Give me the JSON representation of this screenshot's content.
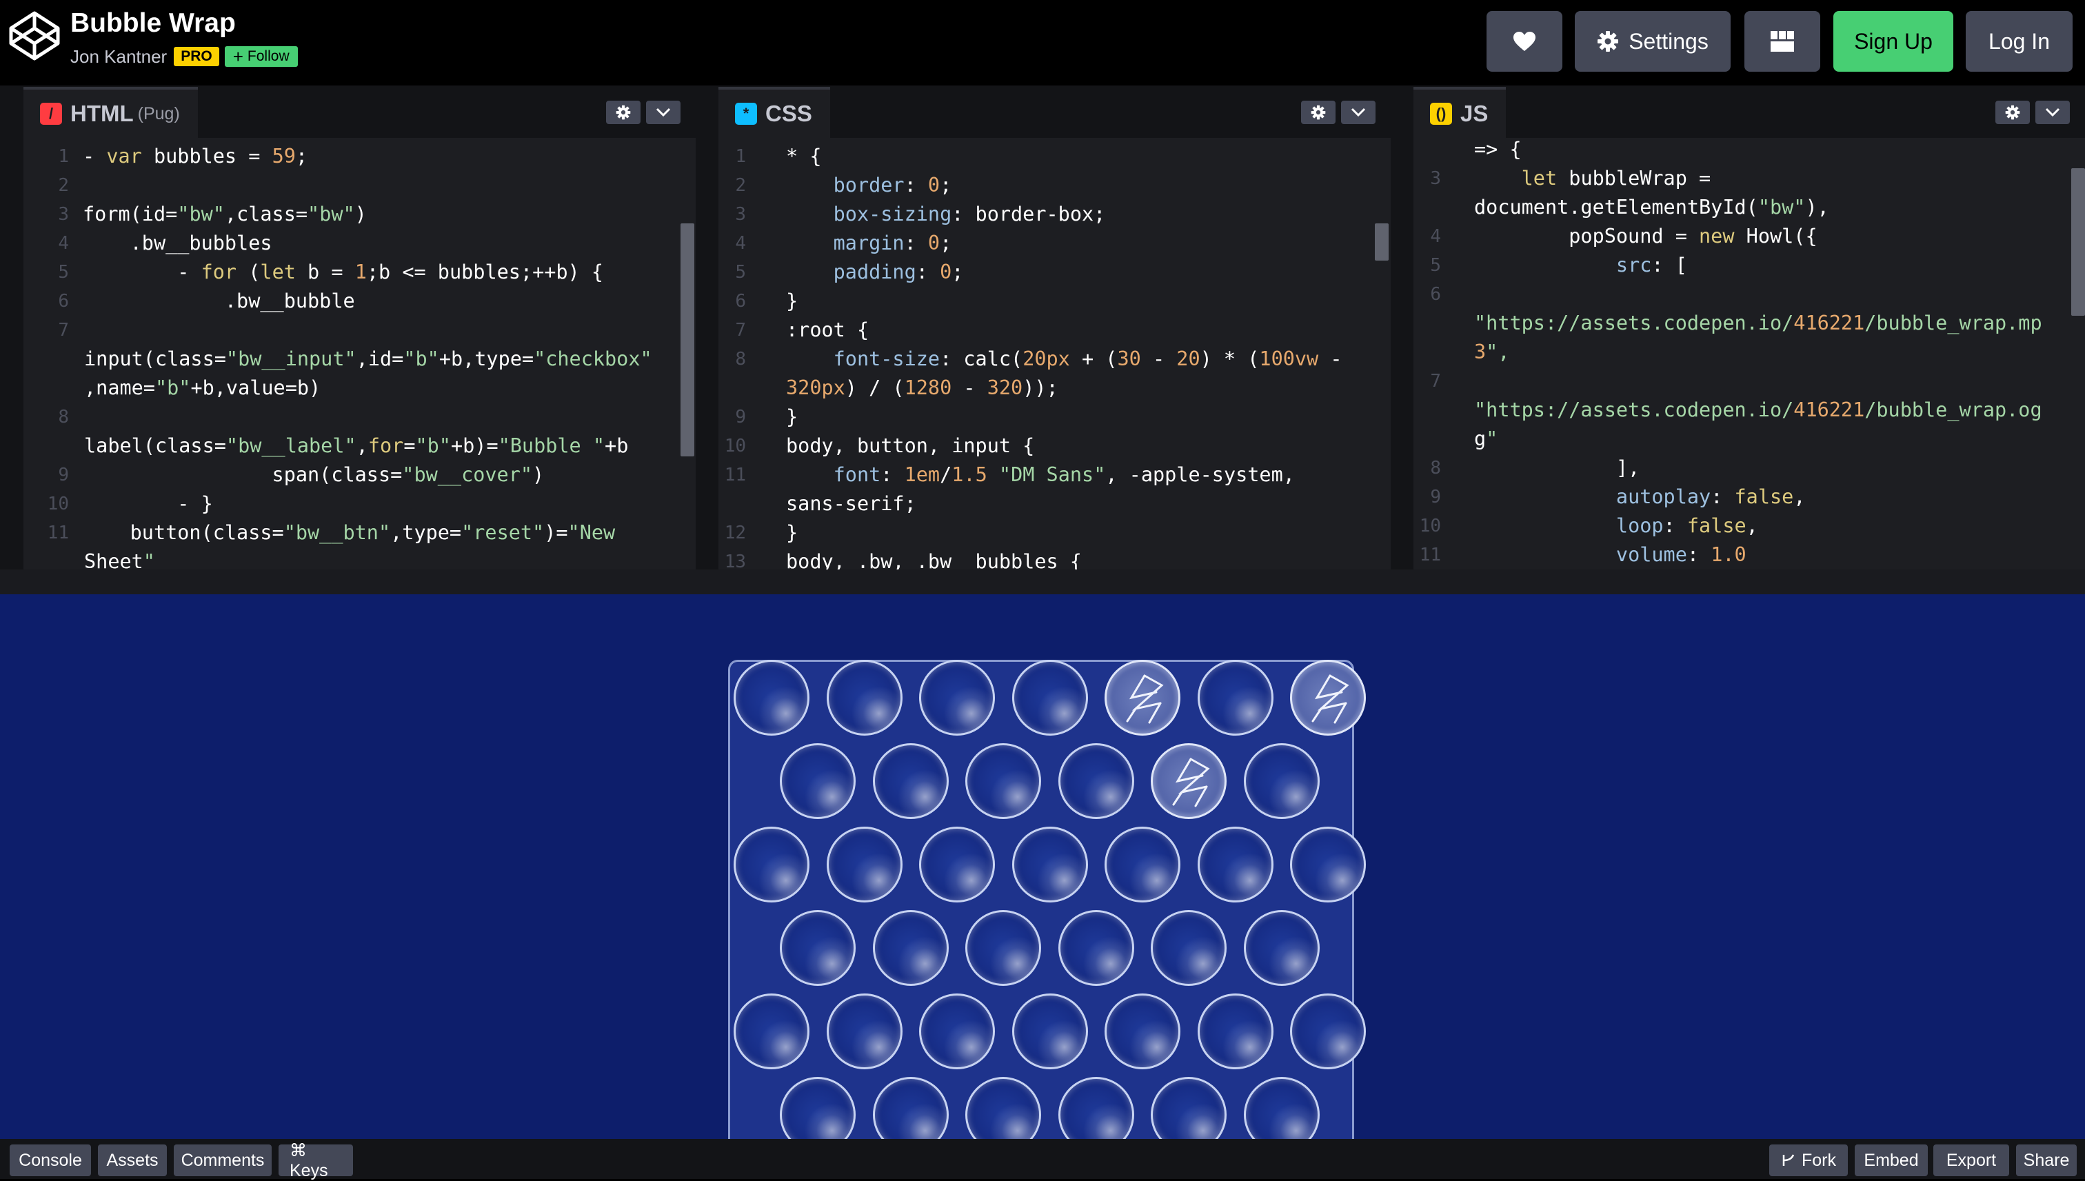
{
  "header": {
    "title": "Bubble Wrap",
    "author": "Jon Kantner",
    "pro_badge": "PRO",
    "follow_label": "Follow",
    "buttons": {
      "settings": "Settings",
      "signup": "Sign Up",
      "login": "Log In"
    },
    "colors": {
      "signup": "#47cf73",
      "pro": "#fcd000"
    }
  },
  "panels": {
    "html": {
      "name": "HTML",
      "preprocessor": "(Pug)",
      "icon": "slash-icon",
      "color": "#ff3c41"
    },
    "css": {
      "name": "CSS",
      "icon": "asterisk-icon",
      "color": "#0ebeff"
    },
    "js": {
      "name": "JS",
      "icon": "braces-icon",
      "color": "#fcd000"
    }
  },
  "code": {
    "html": [
      {
        "n": "1",
        "t": "- var bubbles = 59;"
      },
      {
        "n": "2",
        "t": ""
      },
      {
        "n": "3",
        "t": "form(id=\"bw\",class=\"bw\")"
      },
      {
        "n": "4",
        "t": "    .bw__bubbles"
      },
      {
        "n": "5",
        "t": "        - for (let b = 1;b <= bubbles;++b) {"
      },
      {
        "n": "6",
        "t": "            .bw__bubble"
      },
      {
        "n": "7",
        "t": ""
      },
      {
        "n": "",
        "t": "input(class=\"bw__input\",id=\"b\"+b,type=\"checkbox\""
      },
      {
        "n": "",
        "t": ",name=\"b\"+b,value=b)"
      },
      {
        "n": "8",
        "t": ""
      },
      {
        "n": "",
        "t": "label(class=\"bw__label\",for=\"b\"+b)=\"Bubble \"+b"
      },
      {
        "n": "9",
        "t": "                span(class=\"bw__cover\")"
      },
      {
        "n": "10",
        "t": "        - }"
      },
      {
        "n": "11",
        "t": "    button(class=\"bw__btn\",type=\"reset\")=\"New"
      },
      {
        "n": "",
        "t": "Sheet\""
      }
    ],
    "css": [
      {
        "n": "1",
        "t": "* {"
      },
      {
        "n": "2",
        "t": "    border: 0;"
      },
      {
        "n": "3",
        "t": "    box-sizing: border-box;"
      },
      {
        "n": "4",
        "t": "    margin: 0;"
      },
      {
        "n": "5",
        "t": "    padding: 0;"
      },
      {
        "n": "6",
        "t": "}"
      },
      {
        "n": "7",
        "t": ":root {"
      },
      {
        "n": "8",
        "t": "    font-size: calc(20px + (30 - 20) * (100vw -"
      },
      {
        "n": "",
        "t": "320px) / (1280 - 320));"
      },
      {
        "n": "9",
        "t": "}"
      },
      {
        "n": "10",
        "t": "body, button, input {"
      },
      {
        "n": "11",
        "t": "    font: 1em/1.5 \"DM Sans\", -apple-system,"
      },
      {
        "n": "",
        "t": "sans-serif;"
      },
      {
        "n": "12",
        "t": "}"
      },
      {
        "n": "13",
        "t": "body, .bw, .bw__bubbles {"
      }
    ],
    "js": [
      {
        "n": "",
        "t": "=> {"
      },
      {
        "n": "3",
        "t": "    let bubbleWrap ="
      },
      {
        "n": "",
        "t": "document.getElementById(\"bw\"),"
      },
      {
        "n": "4",
        "t": "        popSound = new Howl({"
      },
      {
        "n": "5",
        "t": "            src: ["
      },
      {
        "n": "6",
        "t": ""
      },
      {
        "n": "",
        "t": "\"https://assets.codepen.io/416221/bubble_wrap.mp"
      },
      {
        "n": "",
        "t": "3\","
      },
      {
        "n": "7",
        "t": ""
      },
      {
        "n": "",
        "t": "\"https://assets.codepen.io/416221/bubble_wrap.og"
      },
      {
        "n": "",
        "t": "g\""
      },
      {
        "n": "8",
        "t": "            ],"
      },
      {
        "n": "9",
        "t": "            autoplay: false,"
      },
      {
        "n": "10",
        "t": "            loop: false,"
      },
      {
        "n": "11",
        "t": "            volume: 1.0"
      }
    ]
  },
  "preview": {
    "background": "#0d1e6b",
    "bubble_rows": [
      7,
      6,
      7,
      6,
      7,
      6
    ],
    "popped": [
      [
        0,
        4
      ],
      [
        0,
        6
      ],
      [
        1,
        4
      ]
    ]
  },
  "footer": {
    "left": [
      "Console",
      "Assets",
      "Comments",
      "⌘ Keys"
    ],
    "fork": "Fork",
    "embed": "Embed",
    "export": "Export",
    "share": "Share"
  }
}
